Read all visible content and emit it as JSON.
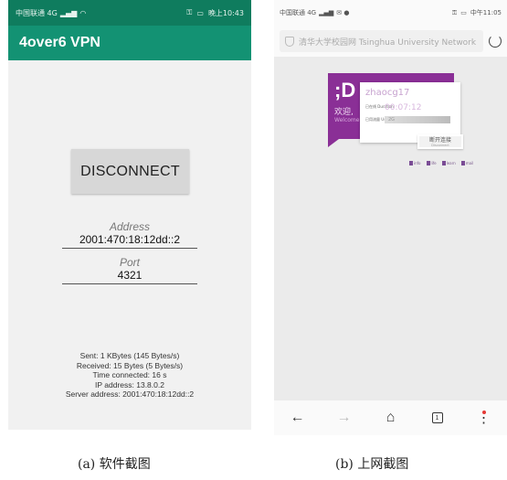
{
  "phoneA": {
    "status": {
      "carrier": "中国联通 4G",
      "time": "晚上10:43"
    },
    "app_title": "4over6 VPN",
    "disconnect_label": "DISCONNECT",
    "address": {
      "label": "Address",
      "value": "2001:470:18:12dd::2"
    },
    "port": {
      "label": "Port",
      "value": "4321"
    },
    "stats": [
      "Sent: 1 KBytes (145 Bytes/s)",
      "Received: 15 Bytes (5 Bytes/s)",
      "Time connected: 16 s",
      "IP address: 13.8.0.2",
      "Server address: 2001:470:18:12dd::2"
    ]
  },
  "phoneB": {
    "status": {
      "carrier": "中国联通 4G",
      "time": "中午11:05"
    },
    "url_text": "清华大学校园网 Tsinghua University Network",
    "portal": {
      "smile": ";D",
      "welcome": "欢迎,",
      "welcome_en": "Welcome,",
      "username": "zhaocg17",
      "duration_label": "已在线 Duration",
      "duration_value": "00:07:12",
      "usage_label": "已用流量 Usage",
      "usage_value": "2G",
      "disconnect_cn": "断开连接",
      "disconnect_en": "Disconnect",
      "links": [
        "info",
        "life",
        "learn",
        "mail"
      ]
    }
  },
  "captions": {
    "a": "(a) 软件截图",
    "b": "(b) 上网截图"
  },
  "colors": {
    "statusbar": "#0f7c5e",
    "appbar": "#139273",
    "portal_purple": "#8a2f96"
  }
}
